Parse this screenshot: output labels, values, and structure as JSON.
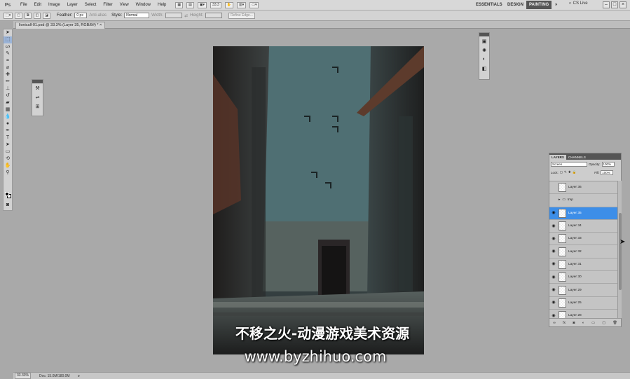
{
  "app": {
    "logo": "Ps"
  },
  "menubar": {
    "items": [
      "File",
      "Edit",
      "Image",
      "Layer",
      "Select",
      "Filter",
      "View",
      "Window",
      "Help"
    ],
    "zoom_value": "33.3",
    "workspaces": [
      "ESSENTIALS",
      "DESIGN",
      "PAINTING"
    ],
    "active_workspace": "PAINTING",
    "more": "»",
    "cs_live": "CS Live"
  },
  "options": {
    "feather_label": "Feather:",
    "feather_value": "0 px",
    "antialias_label": "Anti-alias",
    "style_label": "Style:",
    "style_value": "Normal",
    "width_label": "Width:",
    "height_label": "Height:",
    "refine_edge_label": "Refine Edge..."
  },
  "document": {
    "tab_title": "lionicall-01.psd @ 33.3% (Layer 35, RGB/8#) *"
  },
  "layers_panel": {
    "tabs": [
      "LAYERS",
      "CHANNELS"
    ],
    "blend_mode": "Screen",
    "opacity_label": "Opacity:",
    "opacity_value": "100%",
    "lock_label": "Lock:",
    "fill_label": "Fill:",
    "fill_value": "100%",
    "layers": [
      {
        "name": "Layer 36",
        "visible": false,
        "selected": false,
        "group": false
      },
      {
        "name": "tmp",
        "visible": false,
        "selected": false,
        "group": true
      },
      {
        "name": "Layer 35",
        "visible": true,
        "selected": true,
        "group": false
      },
      {
        "name": "Layer 34",
        "visible": true,
        "selected": false,
        "group": false
      },
      {
        "name": "Layer 33",
        "visible": true,
        "selected": false,
        "group": false
      },
      {
        "name": "Layer 32",
        "visible": true,
        "selected": false,
        "group": false
      },
      {
        "name": "Layer 31",
        "visible": true,
        "selected": false,
        "group": false
      },
      {
        "name": "Layer 30",
        "visible": true,
        "selected": false,
        "group": false
      },
      {
        "name": "Layer 29",
        "visible": true,
        "selected": false,
        "group": false
      },
      {
        "name": "Layer 25",
        "visible": true,
        "selected": false,
        "group": false
      },
      {
        "name": "Layer 28",
        "visible": true,
        "selected": false,
        "group": false
      }
    ]
  },
  "statusbar": {
    "zoom": "33.33%",
    "doc_info": "Doc: 15.0M/180.0M"
  },
  "watermark": {
    "chinese": "不移之火-动漫游戏美术资源",
    "url": "www.byzhihuo.com"
  },
  "colors": {
    "selected_layer": "#3d8ee8",
    "workspace_active": "#555555"
  }
}
